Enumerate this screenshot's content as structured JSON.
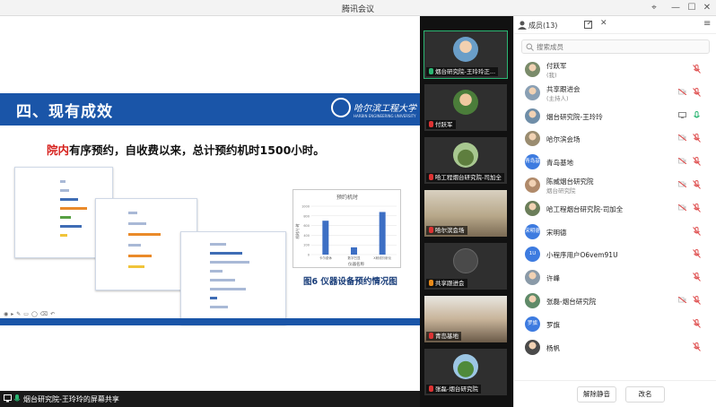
{
  "window": {
    "title": "腾讯会议"
  },
  "slide": {
    "heading": "四、现有成效",
    "school": "哈尔滨工程大学",
    "school_en": "HARBIN ENGINEERING UNIVERSITY",
    "subtitle_red": "院内",
    "subtitle_rest": "有序预约，自收费以来，总计预约机时1500小时。",
    "caption": "图6 仪器设备预约情况图",
    "chart_data": {
      "type": "bar",
      "title": "预约机时",
      "categories": [
        "卡尔费休",
        "数字凹显",
        "X射线衍射仪"
      ],
      "values": [
        700,
        150,
        880
      ],
      "ylim": [
        0,
        1000
      ],
      "yticks": [
        "0",
        "200",
        "400",
        "600",
        "800",
        "1000"
      ],
      "xlabel": "仪器名称",
      "ylabel": "机时/小时"
    }
  },
  "share_footer": "烟台研究院-王玲玲的屏幕共享",
  "video_tiles": [
    {
      "label": "烟台研究院-王玲玲正..."
    },
    {
      "label": "付跃军"
    },
    {
      "label": "哈工程烟台研究院-司加全"
    },
    {
      "label": "哈尔滨会场"
    },
    {
      "label": "共享跟进会"
    },
    {
      "label": "青岛基地"
    },
    {
      "label": "张磊-烟台研究院"
    }
  ],
  "panel": {
    "title": "成员(13)",
    "search_placeholder": "搜索成员",
    "members": [
      {
        "name": "付跃军",
        "sub": "(我)",
        "avatar": "photo",
        "color": "#7a8b6a"
      },
      {
        "name": "共享跟进会",
        "sub": "(主持人)",
        "avatar": "photo",
        "color": "#8aa0b4"
      },
      {
        "name": "烟台研究院-王玲玲",
        "sub": "",
        "avatar": "photo",
        "color": "#6f8ea8"
      },
      {
        "name": "哈尔滨会场",
        "sub": "",
        "avatar": "photo",
        "color": "#9a8c70"
      },
      {
        "name": "青岛基地",
        "sub": "",
        "avatar": "青岛基地",
        "color": "#3d7be0"
      },
      {
        "name": "陈威烟台研究院",
        "sub": "烟台研究院",
        "avatar": "photo",
        "color": "#b08a6a"
      },
      {
        "name": "哈工程烟台研究院-司加全",
        "sub": "",
        "avatar": "photo",
        "color": "#6b7e5a"
      },
      {
        "name": "宋明德",
        "sub": "",
        "avatar": "宋明德",
        "color": "#3d7be0"
      },
      {
        "name": "小程序用户O6vem91U",
        "sub": "",
        "avatar": "1U",
        "color": "#3d7be0"
      },
      {
        "name": "许峰",
        "sub": "",
        "avatar": "photo",
        "color": "#8a9aa8"
      },
      {
        "name": "张磊-烟台研究院",
        "sub": "",
        "avatar": "photo",
        "color": "#5f8a68"
      },
      {
        "name": "罗旗",
        "sub": "",
        "avatar": "罗旗",
        "color": "#3d7be0"
      },
      {
        "name": "杨帆",
        "sub": "",
        "avatar": "photo",
        "color": "#4a4a4a"
      }
    ],
    "btn_mute_all": "解除静音",
    "btn_rename": "改名"
  }
}
